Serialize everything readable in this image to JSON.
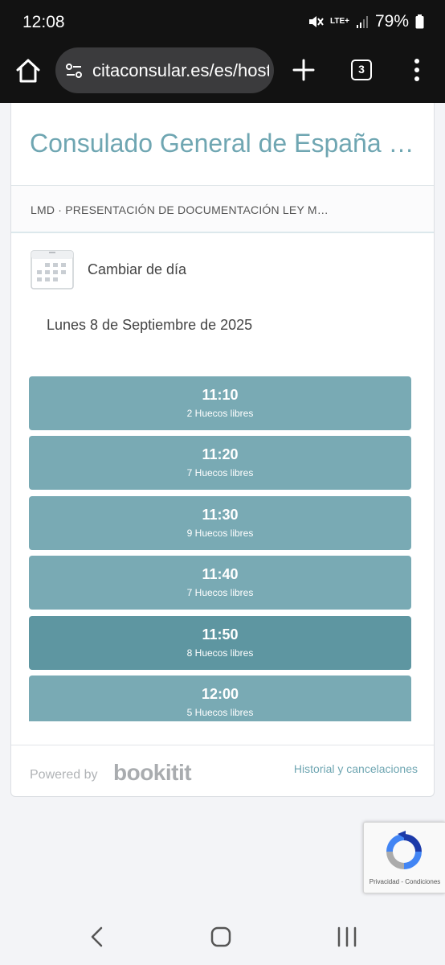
{
  "status_bar": {
    "time": "12:08",
    "network": "LTE+",
    "battery": "79%"
  },
  "browser": {
    "url": "citaconsular.es/es/hosteds/widgetdefault",
    "tab_count": "3"
  },
  "page": {
    "title": "Consulado General de España en Buenos Aires",
    "service": "LMD · PRESENTACIÓN DE DOCUMENTACIÓN LEY MEMORIA DEMOCRÁTICA",
    "change_day_label": "Cambiar de día",
    "date": "Lunes 8 de Septiembre de 2025",
    "slots": [
      {
        "time": "11:10",
        "free": "2 Huecos libres"
      },
      {
        "time": "11:20",
        "free": "7 Huecos libres"
      },
      {
        "time": "11:30",
        "free": "9 Huecos libres"
      },
      {
        "time": "11:40",
        "free": "7 Huecos libres"
      },
      {
        "time": "11:50",
        "free": "8 Huecos libres"
      },
      {
        "time": "12:00",
        "free": "5 Huecos libres"
      }
    ],
    "footer": {
      "powered_by": "Powered by",
      "brand": "bookitit",
      "history_link": "Historial y cancelaciones"
    }
  },
  "recaptcha": {
    "privacy": "Privacidad",
    "separator": "-",
    "terms": "Condiciones"
  },
  "colors": {
    "accent": "#6fa6b2",
    "slot": "#79aab4",
    "slot_active": "#5e96a1"
  }
}
